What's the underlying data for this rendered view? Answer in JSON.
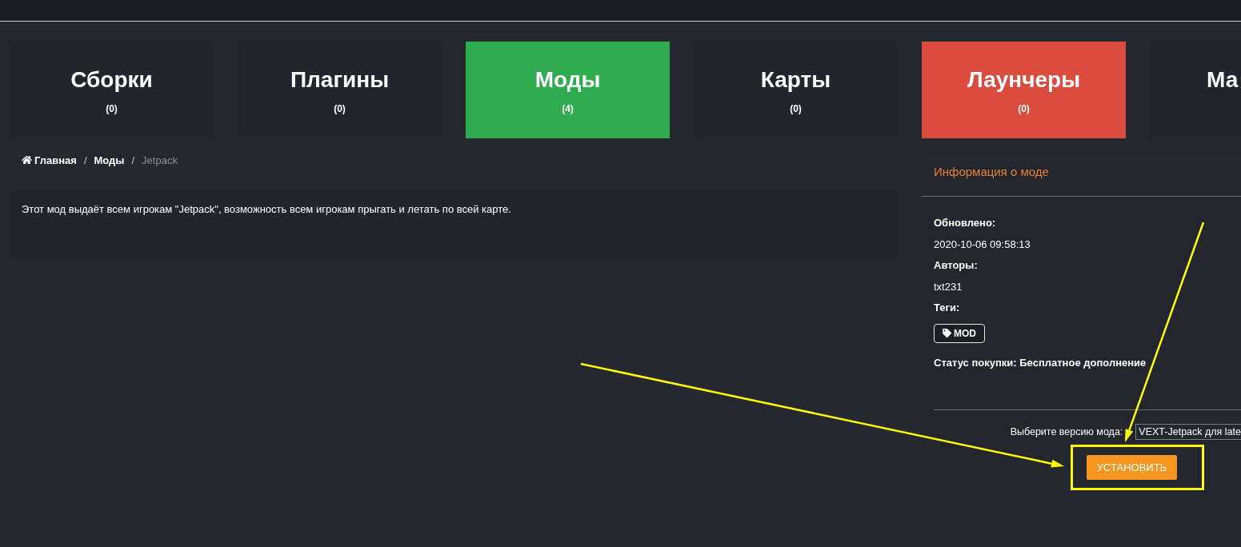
{
  "categories": [
    {
      "title": "Сборки",
      "count": "(0)",
      "color": "#22252b"
    },
    {
      "title": "Плагины",
      "count": "(0)",
      "color": "#22252b"
    },
    {
      "title": "Моды",
      "count": "(4)",
      "color": "#2fac4f"
    },
    {
      "title": "Карты",
      "count": "(0)",
      "color": "#22252b"
    },
    {
      "title": "Лаунчеры",
      "count": "(0)",
      "color": "#db4c3f"
    },
    {
      "title": "Ма",
      "color": "#22252b"
    }
  ],
  "breadcrumb": [
    {
      "kind": "home",
      "label": "Главная"
    },
    {
      "kind": "separator",
      "label": "/"
    },
    {
      "kind": "link",
      "label": "Моды"
    },
    {
      "kind": "separator",
      "label": "/"
    },
    {
      "kind": "current",
      "label": "Jetpack"
    }
  ],
  "description": "Этот мод выдаёт всем игрокам \"Jetpack\", возможность всем игрокам прыгать и летать по всей карте.",
  "mod_info": {
    "title": "Информация о моде",
    "details": [
      {
        "label": "Обновлено:",
        "value": "2020-10-06 09:58:13"
      },
      {
        "label": "Авторы:",
        "value": "txt231"
      },
      {
        "label": "Теги:",
        "tags": [
          "MOD"
        ]
      }
    ],
    "purchase_status": "Статус покупки: Бесплатное дополнение",
    "version_label": "Выберите версию мода:",
    "version_select": {
      "value": "VEXT-Jetpack для late"
    },
    "install_button": "УСТАНОВИТЬ"
  },
  "annotations": [
    {
      "kind": "arrow"
    },
    {
      "kind": "arrow"
    },
    {
      "kind": "frame"
    }
  ]
}
